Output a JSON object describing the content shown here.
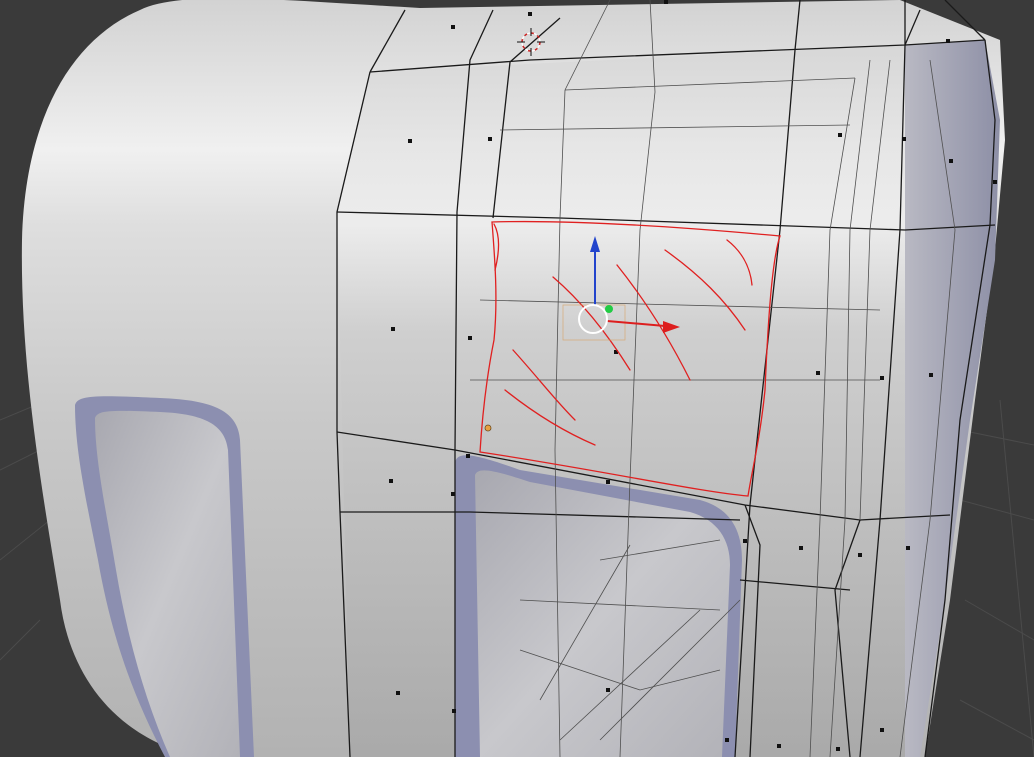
{
  "viewport": {
    "mode": "edit-mode",
    "colors": {
      "background": "#3a3a3a",
      "grid": "#4b4b4b",
      "surface_light": "#e6e6e6",
      "surface_mid": "#c8c8c8",
      "surface_dark": "#9f9f9f",
      "window_frame": "#8c8fb0",
      "window_glass": "#bdbdc2",
      "wire": "#1a1a1a",
      "wire_faint": "#4f4f4f",
      "vertex": "#111111",
      "annotation": "#e02020",
      "gizmo_x": "#dd1e1e",
      "gizmo_z": "#2244cc",
      "gizmo_y": "#22cc44",
      "cursor_ring": "#cc2222",
      "selected_vertex": "#e8a040"
    },
    "icons": [
      "3d-cursor-icon",
      "transform-gizmo-icon",
      "pivot-circle-icon",
      "x-axis-arrow-icon",
      "z-axis-arrow-icon",
      "y-axis-handle-icon"
    ]
  }
}
